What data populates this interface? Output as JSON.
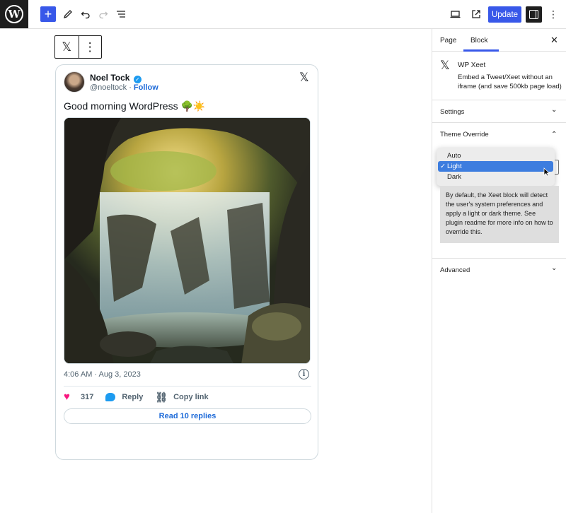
{
  "topbar": {
    "logo_letter": "W",
    "add_symbol": "+",
    "update_label": "Update"
  },
  "block_toolbar": {
    "block_icon": "𝕏",
    "more_icon": "⋮"
  },
  "tweet": {
    "author_name": "Noel Tock",
    "verified_icon": "✓",
    "handle": "@noeltock",
    "separator": " · ",
    "follow_label": "Follow",
    "x_logo": "𝕏",
    "text": "Good morning WordPress 🌳☀️",
    "timestamp": "4:06 AM · Aug 3, 2023",
    "info_icon": "i",
    "likes": "317",
    "reply_label": "Reply",
    "copy_link_label": "Copy link",
    "read_replies_label": "Read 10 replies"
  },
  "sidebar": {
    "tab_page": "Page",
    "tab_block": "Block",
    "close_icon": "✕",
    "block_icon": "𝕏",
    "block_title": "WP Xeet",
    "block_description": "Embed a Tweet/Xeet without an iframe (and save 500kb page load)",
    "settings_label": "Settings",
    "theme_override_label": "Theme Override",
    "theme_options": [
      "Auto",
      "Light",
      "Dark"
    ],
    "theme_selected": "Light",
    "help_text": "By default, the Xeet block will detect the user's system preferences and apply a light or dark theme. See plugin readme for more info on how to override this.",
    "advanced_label": "Advanced"
  },
  "colors": {
    "accent": "#3858e9",
    "twitter_blue": "#1d9bf0",
    "like_pink": "#f91880",
    "dropdown_highlight": "#3d7ddf"
  }
}
